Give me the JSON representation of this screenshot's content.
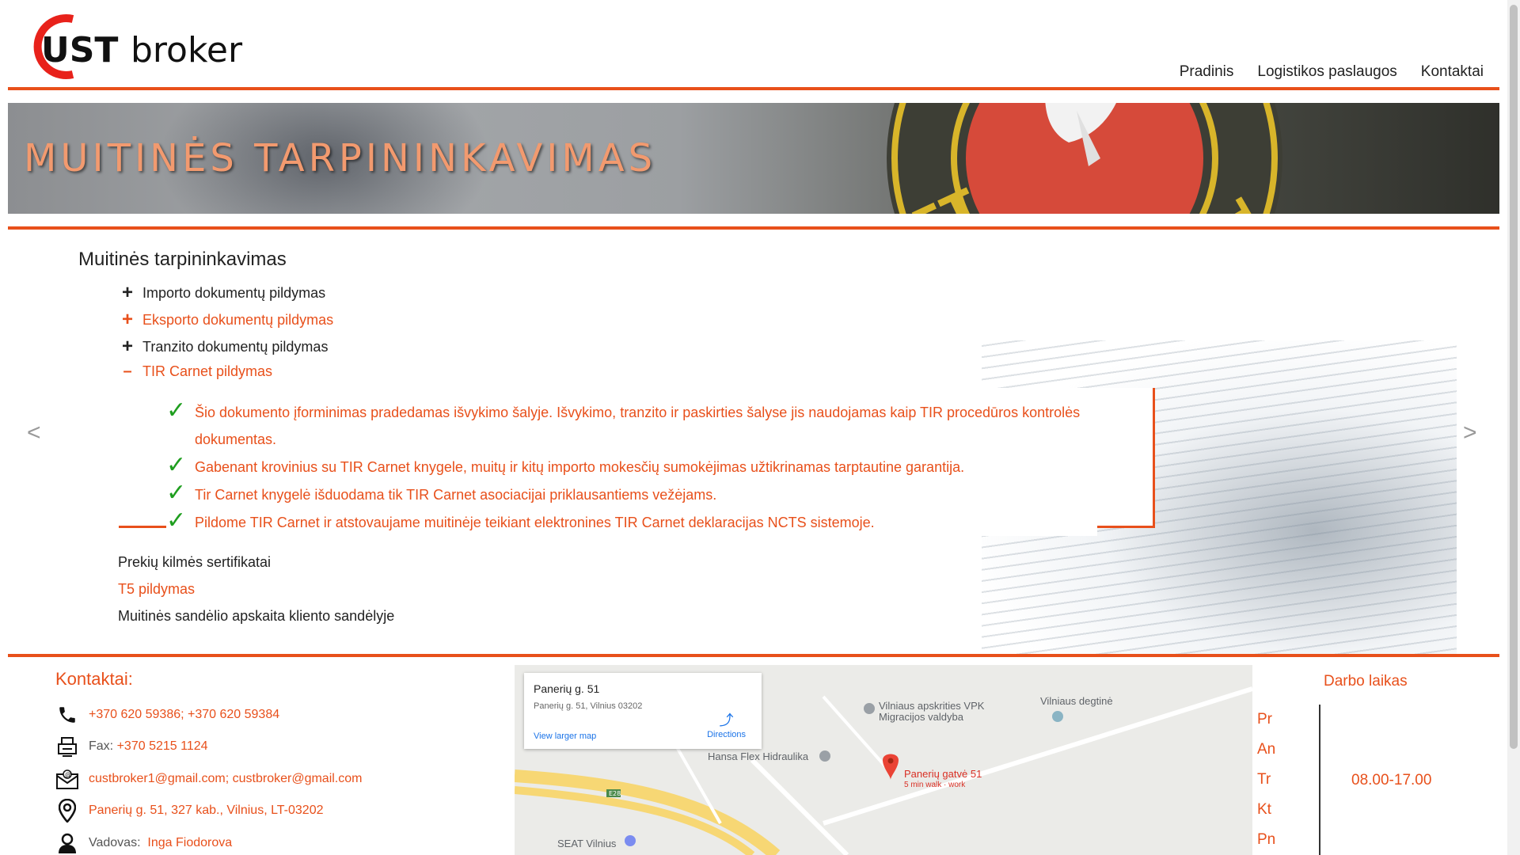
{
  "brand": {
    "logo_letters": "UST",
    "logo_word": "broker"
  },
  "nav": [
    {
      "label": "Pradinis"
    },
    {
      "label": "Logistikos paslaugos"
    },
    {
      "label": "Kontaktai"
    }
  ],
  "banner": {
    "title": "MUITINĖS TARPININKAVIMAS"
  },
  "main": {
    "title": "Muitinės tarpininkavimas",
    "items": [
      {
        "symbol": "+",
        "label": "Importo dokumentų pildymas"
      },
      {
        "symbol": "+",
        "label": "Eksporto dokumentų pildymas"
      },
      {
        "symbol": "+",
        "label": "Tranzito dokumentų pildymas"
      },
      {
        "symbol": "–",
        "label": "TIR Carnet pildymas"
      }
    ],
    "tir_bullets": [
      "Šio dokumento įforminimas pradedamas išvykimo šalyje. Išvykimo, tranzito ir paskirties šalyse jis naudojamas kaip TIR procedūros kontrolės dokumentas.",
      "Gabenant krovinius su TIR Carnet knygele, muitų ir kitų importo mokesčių sumokėjimas užtikrinamas tarptautine garantija.",
      "Tir Carnet knygelė išduodama tik TIR Carnet asociacijai priklausantiems vežėjams.",
      "Pildome TIR Carnet ir atstovaujame muitinėje teikiant elektronines TIR Carnet deklaracijas NCTS sistemoje."
    ],
    "more_items": [
      {
        "label": "Prekių kilmės sertifikatai"
      },
      {
        "label": "T5 pildymas"
      },
      {
        "label": "Muitinės sandėlio apskaita kliento sandėlyje"
      }
    ],
    "slider_prev": "<",
    "slider_next": ">"
  },
  "contacts": {
    "title": "Kontaktai:",
    "phone": "+370 620 59386; +370 620 59384",
    "fax_label": "Fax:",
    "fax": "+370 5215 1124",
    "email": "custbroker1@gmail.com; custbroker@gmail.com",
    "address": "Panerių g. 51, 327 kab., Vilnius, LT-03202",
    "manager_label": "Vadovas:",
    "manager": "Inga Fiodorova"
  },
  "map": {
    "card_title": "Panerių g. 51",
    "card_subtitle": "Panerių g. 51, Vilnius 03202",
    "directions": "Directions",
    "larger_map": "View larger map",
    "labels": {
      "vpk": "Vilniaus apskrities VPK",
      "vpk2": "Migracijos valdyba",
      "degtine": "Vilniaus degtinė",
      "hansa": "Hansa Flex Hidraulika",
      "pin": "Panerių gatvė 51",
      "pin_sub": "5 min walk · work",
      "seat": "SEAT Vilnius",
      "road": "E28"
    }
  },
  "hours": {
    "title": "Darbo laikas",
    "days": [
      "Pr",
      "An",
      "Tr",
      "Kt",
      "Pn"
    ],
    "time": "08.00-17.00"
  },
  "colors": {
    "accent": "#e8501b",
    "check": "#1f9e1f"
  }
}
